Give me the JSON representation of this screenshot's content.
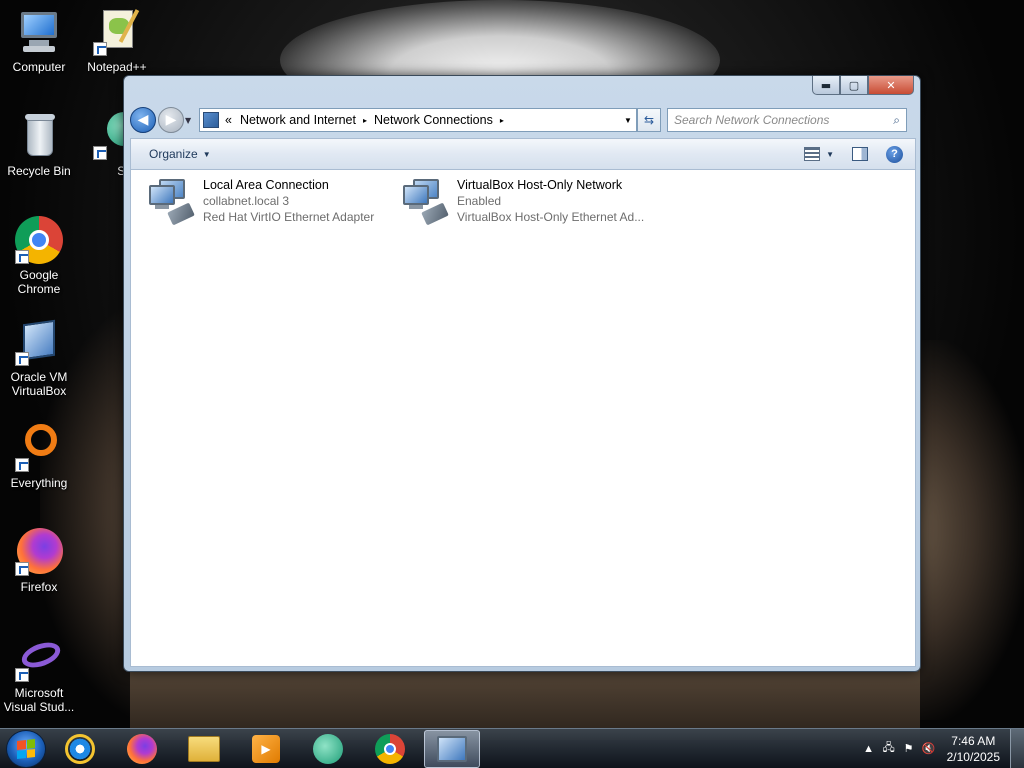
{
  "desktop": {
    "icons": [
      {
        "label_line1": "Computer",
        "label_line2": ""
      },
      {
        "label_line1": "Notepad++",
        "label_line2": ""
      },
      {
        "label_line1": "Recycle Bin",
        "label_line2": ""
      },
      {
        "label_line1": "Supern",
        "label_line2": ""
      },
      {
        "label_line1": "Google",
        "label_line2": "Chrome"
      },
      {
        "label_line1": "Oracle VM",
        "label_line2": "VirtualBox"
      },
      {
        "label_line1": "Everything",
        "label_line2": ""
      },
      {
        "label_line1": "Firefox",
        "label_line2": ""
      },
      {
        "label_line1": "Microsoft",
        "label_line2": "Visual Stud..."
      }
    ]
  },
  "window": {
    "controls": {
      "minimize": "▬",
      "maximize": "▢",
      "close": "✕"
    },
    "address": {
      "prefix": "«",
      "crumbs": [
        "Network and Internet",
        "Network Connections"
      ],
      "separator": "▸"
    },
    "search": {
      "placeholder": "Search Network Connections"
    },
    "toolbar": {
      "organize_label": "Organize"
    },
    "connections": [
      {
        "name": "Local Area Connection",
        "status": "collabnet.local  3",
        "adapter": "Red Hat VirtIO Ethernet Adapter"
      },
      {
        "name": "VirtualBox Host-Only Network",
        "status": "Enabled",
        "adapter": "VirtualBox Host-Only Ethernet Ad..."
      }
    ]
  },
  "taskbar": {
    "apps": [
      "start",
      "internet-explorer",
      "firefox",
      "file-explorer",
      "media-player",
      "supernova",
      "chrome",
      "network-connections"
    ],
    "active_app": "network-connections",
    "clock": {
      "time": "7:46 AM",
      "date": "2/10/2025"
    },
    "tray_icons": [
      "show-hidden-icons",
      "network",
      "action-center-flag",
      "volume-muted"
    ]
  },
  "colors": {
    "accent": "#1c5fb5",
    "close_button": "#c84c34",
    "secondary_text": "#6d6d6d",
    "toolbar_text": "#1e395b"
  }
}
